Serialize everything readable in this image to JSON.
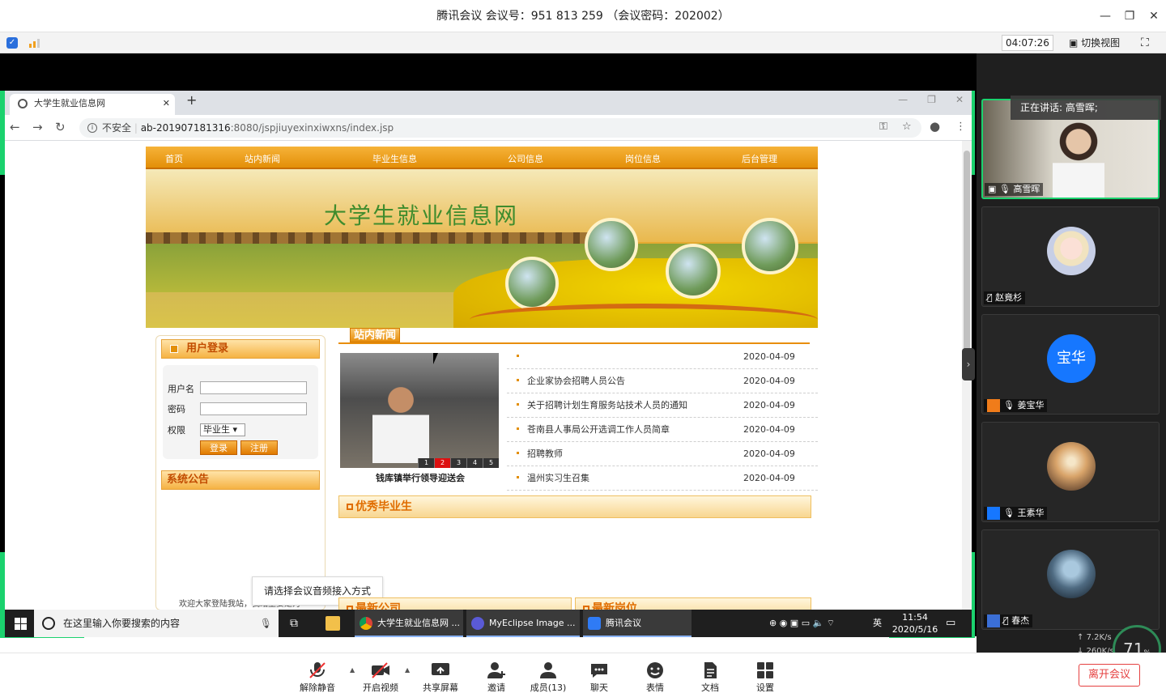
{
  "meeting": {
    "title": "腾讯会议 会议号：951 813 259 （会议密码：202002）",
    "timer": "04:07:26",
    "switch_view": "切换视图"
  },
  "browser": {
    "tab_title": "大学生就业信息网",
    "url_host": "ab-201907181316",
    "url_path": ":8080/jspjiuyexinxiwxns/index.jsp",
    "insecure_label": "不安全"
  },
  "site": {
    "nav": [
      "首页",
      "站内新闻",
      "毕业生信息",
      "公司信息",
      "岗位信息",
      "后台管理"
    ],
    "banner_title": "大学生就业信息网",
    "login_header": "用户登录",
    "username_label": "用户名",
    "password_label": "密码",
    "role_label": "权限",
    "role_value": "毕业生",
    "login_button": "登录",
    "register_button": "注册",
    "notice_header": "系统公告",
    "welcome_text": "欢迎大家登陆我站，我站主要是为",
    "news_header": "站内新闻",
    "photo_caption": "钱库镇举行领导迎送会",
    "photo_pages": [
      "1",
      "2",
      "3",
      "4",
      "5"
    ],
    "news": [
      {
        "title": "",
        "date": "2020-04-09"
      },
      {
        "title": "企业家协会招聘人员公告",
        "date": "2020-04-09"
      },
      {
        "title": "关于招聘计划生育服务站技术人员的通知",
        "date": "2020-04-09"
      },
      {
        "title": "苍南县人事局公开选调工作人员简章",
        "date": "2020-04-09"
      },
      {
        "title": "招聘教师",
        "date": "2020-04-09"
      },
      {
        "title": "温州实习生召集",
        "date": "2020-04-09"
      }
    ],
    "grad_header": "优秀毕业生",
    "company_header": "最新公司",
    "jobs_header": "最新岗位",
    "audio_tooltip": "请选择会议音频接入方式"
  },
  "taskbar": {
    "search_placeholder": "在这里输入你要搜索的内容",
    "apps": [
      "大学生就业信息网 ...",
      "MyEclipse Image ...",
      "腾讯会议"
    ],
    "ime": "英",
    "time": "11:54",
    "date": "2020/5/16"
  },
  "participants": {
    "speaking": "正在讲话: 高雪晖;",
    "list": [
      {
        "name": "高雪晖",
        "kind": "video"
      },
      {
        "name": "赵竟杉",
        "kind": "avatar"
      },
      {
        "name": "姜宝华",
        "kind": "initials",
        "initials": "宝华"
      },
      {
        "name": "王素华",
        "kind": "avatar"
      },
      {
        "name": "春杰",
        "kind": "avatar"
      }
    ],
    "up_speed": "7.2K/s",
    "down_speed": "260K/s",
    "cpu": "71",
    "cpu_unit": "%"
  },
  "controls": {
    "buttons": [
      "解除静音",
      "开启视频",
      "共享屏幕",
      "邀请",
      "成员(13)",
      "聊天",
      "表情",
      "文档",
      "设置"
    ],
    "leave": "离开会议"
  },
  "colors": {
    "accent_green": "#1bd26e",
    "site_orange": "#e38f08",
    "leave_red": "#e54040"
  }
}
